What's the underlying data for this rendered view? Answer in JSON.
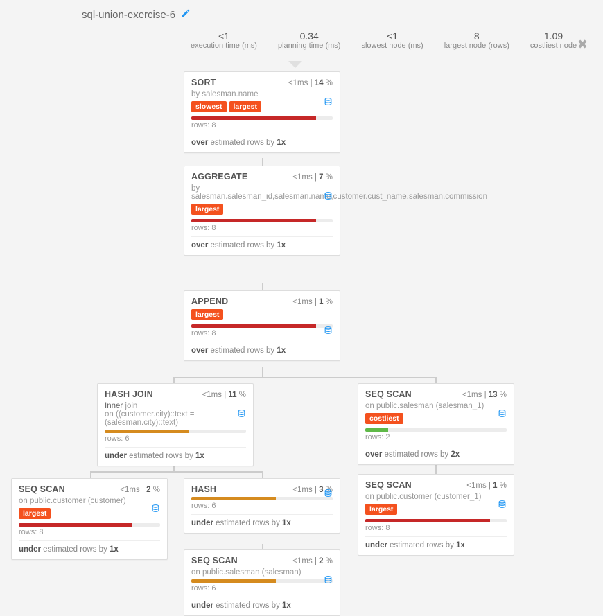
{
  "title": "sql-union-exercise-6",
  "stats": {
    "exec_value": "<1",
    "exec_label": "execution time (ms)",
    "plan_value": "0.34",
    "plan_label": "planning time (ms)",
    "slow_value": "<1",
    "slow_label": "slowest node (ms)",
    "largest_value": "8",
    "largest_label": "largest node (rows)",
    "cost_value": "1.09",
    "cost_label": "costliest node"
  },
  "labels": {
    "ms": "ms",
    "pct": "%",
    "rows_prefix": "rows:",
    "over": "over",
    "under": "under",
    "est_mid": " estimated rows by ",
    "by": "by ",
    "on": "on ",
    "join_word": "join"
  },
  "badges": {
    "slowest": "slowest",
    "largest": "largest",
    "costliest": "costliest"
  },
  "nodes": {
    "sort": {
      "title": "SORT",
      "time": "<1",
      "pct": "14",
      "sub": "salesman.name",
      "badge1": "slowest",
      "badge2": "largest",
      "bar_pct": 88,
      "rows": "8",
      "est_dir": "over",
      "est_x": "1x"
    },
    "aggregate": {
      "title": "AGGREGATE",
      "time": "<1",
      "pct": "7",
      "sub": "salesman.salesman_id,salesman.name,customer.cust_name,salesman.commission",
      "badge": "largest",
      "bar_pct": 88,
      "rows": "8",
      "est_dir": "over",
      "est_x": "1x"
    },
    "append": {
      "title": "APPEND",
      "time": "<1",
      "pct": "1",
      "badge": "largest",
      "bar_pct": 88,
      "rows": "8",
      "est_dir": "over",
      "est_x": "1x"
    },
    "hashjoin": {
      "title": "HASH JOIN",
      "time": "<1",
      "pct": "11",
      "join_type": "Inner ",
      "cond": "on ((customer.city)::text = (salesman.city)::text)",
      "bar_pct": 60,
      "rows": "6",
      "est_dir": "under",
      "est_x": "1x"
    },
    "seq_salesman1": {
      "title": "SEQ SCAN",
      "time": "<1",
      "pct": "13",
      "sub": "public.salesman (salesman_1)",
      "badge": "costliest",
      "bar_pct": 16,
      "rows": "2",
      "est_dir": "over",
      "est_x": "2x"
    },
    "seq_customer": {
      "title": "SEQ SCAN",
      "time": "<1",
      "pct": "2",
      "sub": "public.customer (customer)",
      "badge": "largest",
      "bar_pct": 80,
      "rows": "8",
      "est_dir": "under",
      "est_x": "1x"
    },
    "hash": {
      "title": "HASH",
      "time": "<1",
      "pct": "3",
      "bar_pct": 60,
      "rows": "6",
      "est_dir": "under",
      "est_x": "1x"
    },
    "seq_customer1": {
      "title": "SEQ SCAN",
      "time": "<1",
      "pct": "1",
      "sub": "public.customer (customer_1)",
      "badge": "largest",
      "bar_pct": 88,
      "rows": "8",
      "est_dir": "under",
      "est_x": "1x"
    },
    "seq_salesman": {
      "title": "SEQ SCAN",
      "time": "<1",
      "pct": "2",
      "sub": "public.salesman (salesman)",
      "bar_pct": 60,
      "rows": "6",
      "est_dir": "under",
      "est_x": "1x"
    }
  }
}
